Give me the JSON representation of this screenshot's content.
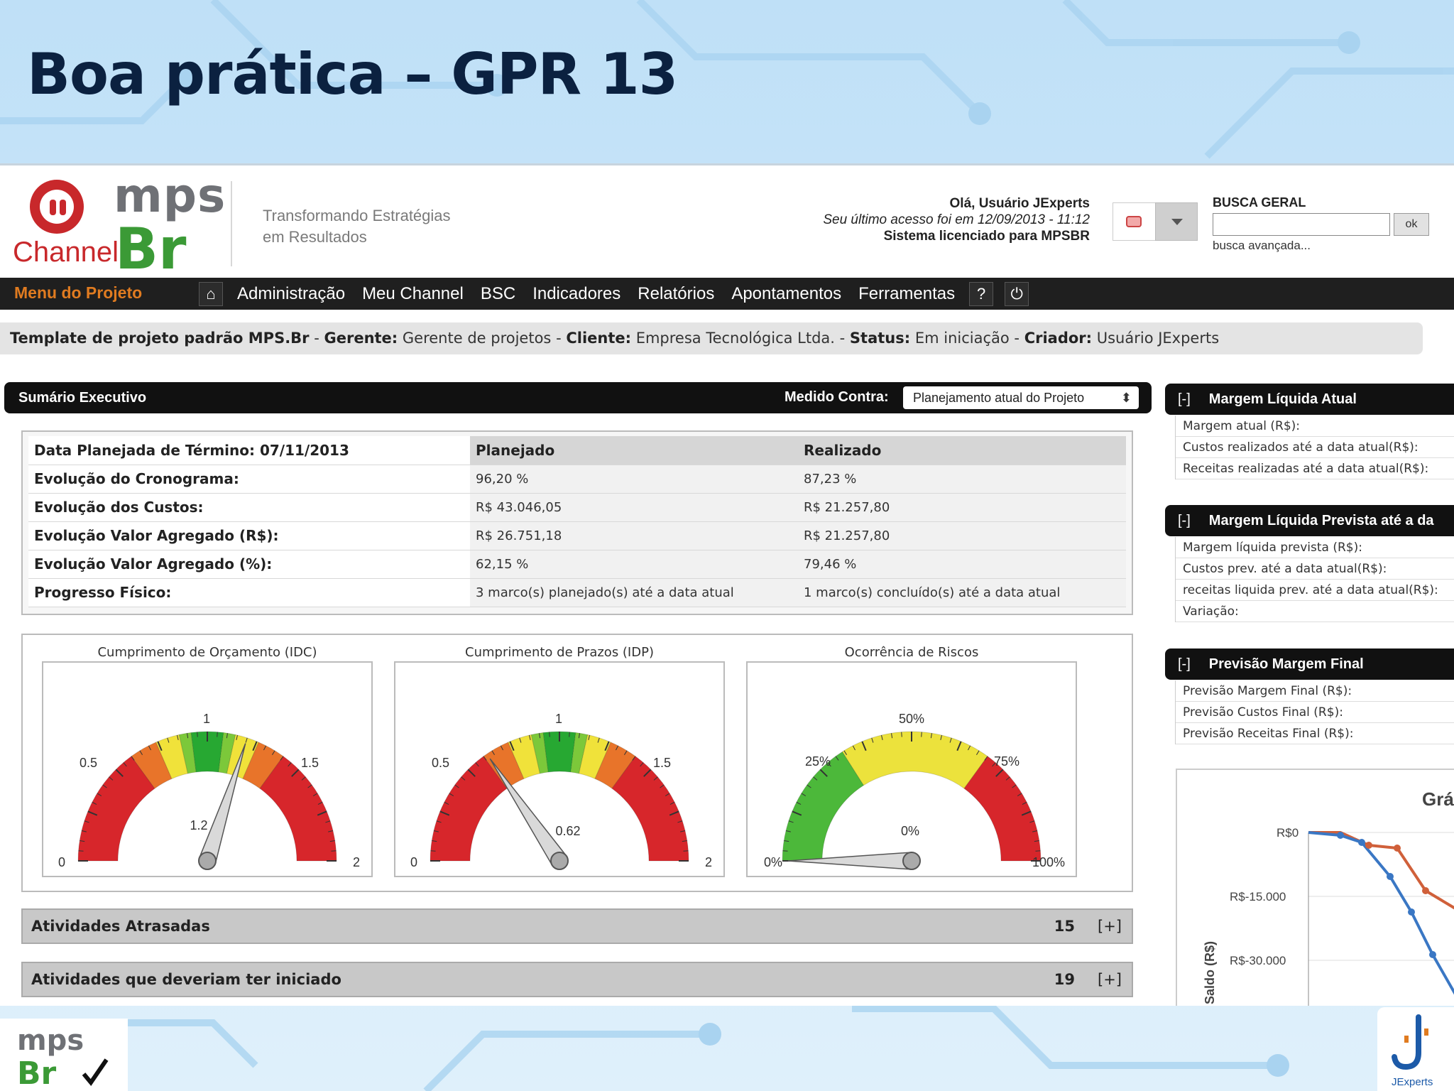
{
  "slide": {
    "title": "Boa prática – GPR 13"
  },
  "header": {
    "logo_channel": "Channel",
    "logo_mps": "mps",
    "logo_br": "Br",
    "tagline_1": "Transformando Estratégias",
    "tagline_2": "em Resultados",
    "greeting": "Olá, Usuário JExperts",
    "last_access": "Seu último acesso foi em 12/09/2013 - 11:12",
    "license": "Sistema licenciado para MPSBR",
    "search_label": "BUSCA GERAL",
    "search_value": "",
    "search_button": "ok",
    "advanced_search": "busca avançada..."
  },
  "menu": {
    "title": "Menu do Projeto",
    "items": [
      "Administração",
      "Meu Channel",
      "BSC",
      "Indicadores",
      "Relatórios",
      "Apontamentos",
      "Ferramentas"
    ],
    "help": "?"
  },
  "breadcrumb": {
    "project": "Template de projeto padrão MPS.Br",
    "sep": "-",
    "manager_label": "Gerente:",
    "manager": "Gerente de projetos",
    "client_label": "Cliente:",
    "client": "Empresa Tecnológica Ltda.",
    "status_label": "Status:",
    "status": "Em iniciação",
    "creator_label": "Criador:",
    "creator": "Usuário JExperts"
  },
  "summary": {
    "title": "Sumário Executivo",
    "measured_label": "Medido Contra:",
    "measured_value": "Planejamento atual do Projeto",
    "header": [
      "Data Planejada de Término: 07/11/2013",
      "Planejado",
      "Realizado"
    ],
    "rows": [
      [
        "Evolução do Cronograma:",
        "96,20 %",
        "87,23 %"
      ],
      [
        "Evolução dos Custos:",
        "R$ 43.046,05",
        "R$ 21.257,80"
      ],
      [
        "Evolução Valor Agregado (R$):",
        "R$ 26.751,18",
        "R$ 21.257,80"
      ],
      [
        "Evolução Valor Agregado (%):",
        "62,15 %",
        "79,46 %"
      ],
      [
        "Progresso Físico:",
        "3 marco(s) planejado(s) até a data atual",
        "1 marco(s) concluído(s) até a data atual"
      ]
    ]
  },
  "gauges": [
    {
      "title": "Cumprimento de Orçamento (IDC)",
      "min": "0",
      "low": "0.5",
      "mid": "1",
      "high": "1.5",
      "max": "2",
      "value": 1.2,
      "value_label": "1.2",
      "range": [
        0,
        2
      ]
    },
    {
      "title": "Cumprimento de Prazos (IDP)",
      "min": "0",
      "low": "0.5",
      "mid": "1",
      "high": "1.5",
      "max": "2",
      "value": 0.62,
      "value_label": "0.62",
      "range": [
        0,
        2
      ]
    },
    {
      "title": "Ocorrência de Riscos",
      "min": "0%",
      "low": "25%",
      "mid": "50%",
      "high": "75%",
      "max": "100%",
      "value": 0,
      "value_label": "0%",
      "range": [
        0,
        100
      ]
    }
  ],
  "lists": [
    {
      "label": "Atividades Atrasadas",
      "count": "15",
      "toggle": "[+]"
    },
    {
      "label": "Atividades que deveriam ter iniciado",
      "count": "19",
      "toggle": "[+]"
    }
  ],
  "right_panels": [
    {
      "toggle": "[-]",
      "title": "Margem Líquida Atual",
      "rows": [
        "Margem atual (R$):",
        "Custos realizados até a data atual(R$):",
        "Receitas realizadas até a data atual(R$):"
      ]
    },
    {
      "toggle": "[-]",
      "title": "Margem Líquida Prevista até a da",
      "rows": [
        "Margem líquida prevista (R$):",
        "Custos prev. até a data atual(R$):",
        "receitas liquida prev. até a data atual(R$):",
        "Variação:"
      ]
    },
    {
      "toggle": "[-]",
      "title": "Previsão Margem Final",
      "rows": [
        "Previsão Margem Final (R$):",
        "Previsão Custos Final (R$):",
        "Previsão Receitas Final (R$):"
      ]
    }
  ],
  "mini_chart": {
    "title": "Grá",
    "ylabel": "Saldo (R$)",
    "ticks": [
      "R$0",
      "R$-15.000",
      "R$-30.000"
    ],
    "colors": {
      "series_a": "#3a77c4",
      "series_b": "#d0603a"
    }
  },
  "footer": {
    "left_logo": "mps Br",
    "right_logo": "JExperts"
  }
}
